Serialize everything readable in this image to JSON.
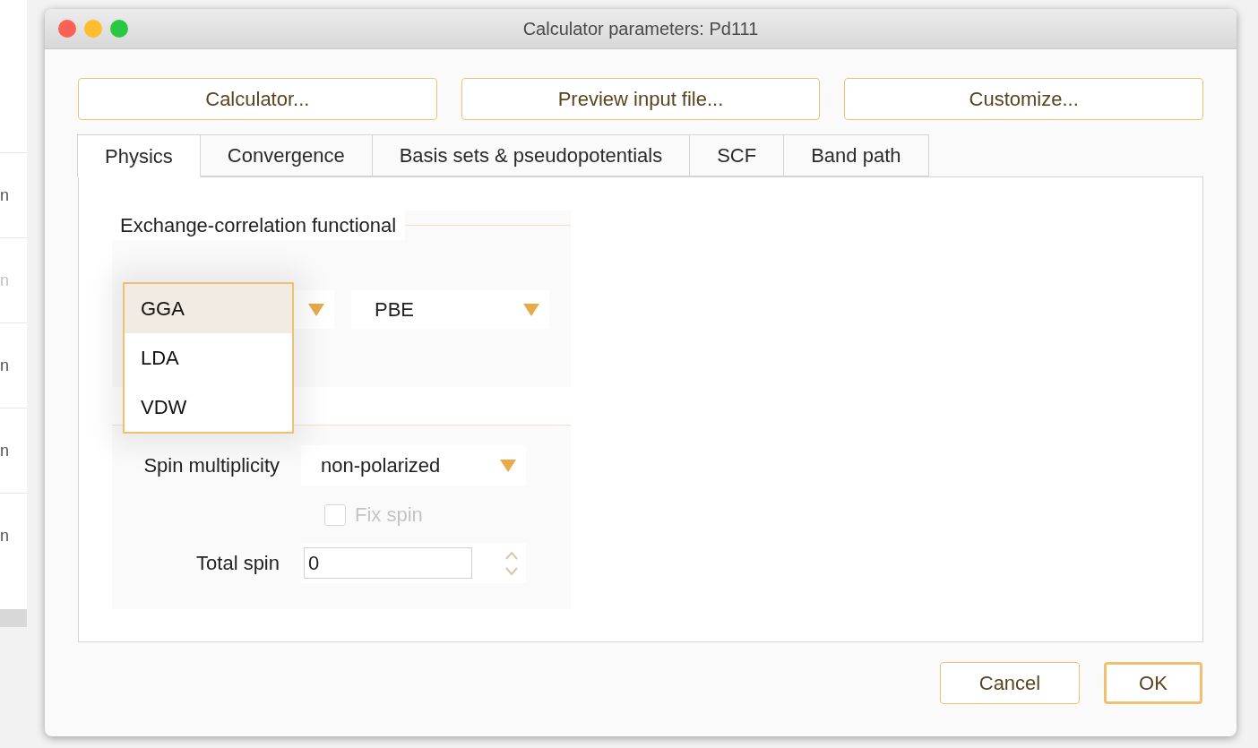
{
  "background_window": {
    "rows": [
      {
        "text": "n",
        "disabled": false
      },
      {
        "text": "n",
        "disabled": true
      },
      {
        "text": "n",
        "disabled": false
      },
      {
        "text": "n",
        "disabled": false
      },
      {
        "text": "n",
        "disabled": false
      }
    ]
  },
  "window": {
    "title": "Calculator parameters: Pd111"
  },
  "top_buttons": [
    "Calculator...",
    "Preview input file...",
    "Customize..."
  ],
  "tabs": [
    {
      "label": "Physics",
      "selected": true
    },
    {
      "label": "Convergence",
      "selected": false
    },
    {
      "label": "Basis sets & pseudopotentials",
      "selected": false
    },
    {
      "label": "SCF",
      "selected": false
    },
    {
      "label": "Band path",
      "selected": false
    }
  ],
  "xc_group": {
    "title": "Exchange-correlation functional",
    "type_menu": [
      {
        "label": "GGA",
        "selected": true
      },
      {
        "label": "LDA",
        "selected": false
      },
      {
        "label": "VDW",
        "selected": false
      }
    ],
    "functional": "PBE"
  },
  "spin_group": {
    "spin_multiplicity": {
      "label": "Spin multiplicity",
      "value": "non-polarized"
    },
    "fix_spin": {
      "label": "Fix spin",
      "checked": false,
      "disabled": true
    },
    "total_spin": {
      "label": "Total spin",
      "value": "0"
    }
  },
  "buttons": [
    {
      "label": "Cancel",
      "default": false
    },
    {
      "label": "OK",
      "default": true
    }
  ]
}
